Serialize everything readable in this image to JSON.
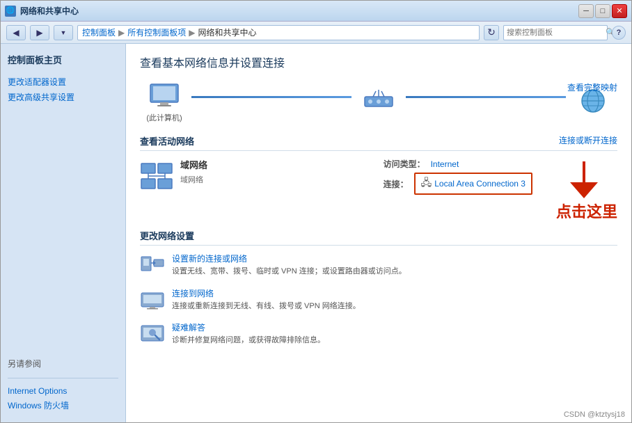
{
  "window": {
    "title": "网络和共享中心",
    "titlebar_icon": "🌐"
  },
  "titlebar": {
    "minimize_label": "─",
    "maximize_label": "□",
    "close_label": "✕"
  },
  "addressbar": {
    "back_icon": "◀",
    "forward_icon": "▶",
    "dropdown_icon": "▼",
    "refresh_icon": "↻",
    "breadcrumb": [
      "控制面板",
      "所有控制面板项",
      "网络和共享中心"
    ],
    "search_placeholder": "搜索控制面板",
    "help_icon": "?"
  },
  "sidebar": {
    "main_title": "控制面板主页",
    "links": [
      {
        "id": "adapter-settings",
        "label": "更改适配器设置"
      },
      {
        "id": "advanced-sharing",
        "label": "更改高级共享设置"
      }
    ],
    "see_also_title": "另请参阅",
    "see_also_links": [
      {
        "id": "internet-options",
        "label": "Internet Options"
      },
      {
        "id": "windows-firewall",
        "label": "Windows 防火墙"
      }
    ]
  },
  "content": {
    "page_title": "查看基本网络信息并设置连接",
    "view_full_map": "查看完整映射",
    "connect_or_disconnect": "连接或断开连接",
    "network_diagram": {
      "nodes": [
        {
          "id": "computer",
          "label": "(此计算机)",
          "icon": "🖥"
        },
        {
          "id": "router",
          "label": "",
          "icon": "🖧"
        },
        {
          "id": "internet",
          "label": "",
          "icon": "🌐"
        }
      ]
    },
    "active_network_section": "查看活动网络",
    "active_network": {
      "name": "域网络",
      "type": "域网络",
      "icon": "🖧",
      "access_type_label": "访问类型：",
      "access_type_value": "Internet",
      "connection_label": "连接：",
      "connection_value": "Local Area Connection 3",
      "connection_icon": "🖧"
    },
    "change_settings_section": "更改网络设置",
    "settings_items": [
      {
        "id": "new-connection",
        "icon": "🔌",
        "title": "设置新的连接或网络",
        "desc": "设置无线、宽带、拨号、临时或 VPN 连接；或设置路由器或访问点。"
      },
      {
        "id": "connect-to-network",
        "icon": "🖥",
        "title": "连接到网络",
        "desc": "连接或重新连接到无线、有线、拨号或 VPN 网络连接。"
      },
      {
        "id": "troubleshoot",
        "icon": "🔧",
        "title": "疑难解答",
        "desc": "诊断并修复网络问题，或获得故障排除信息。"
      }
    ],
    "annotation_text": "点击这里"
  },
  "watermark": {
    "text": "CSDN @ktztysj18"
  }
}
